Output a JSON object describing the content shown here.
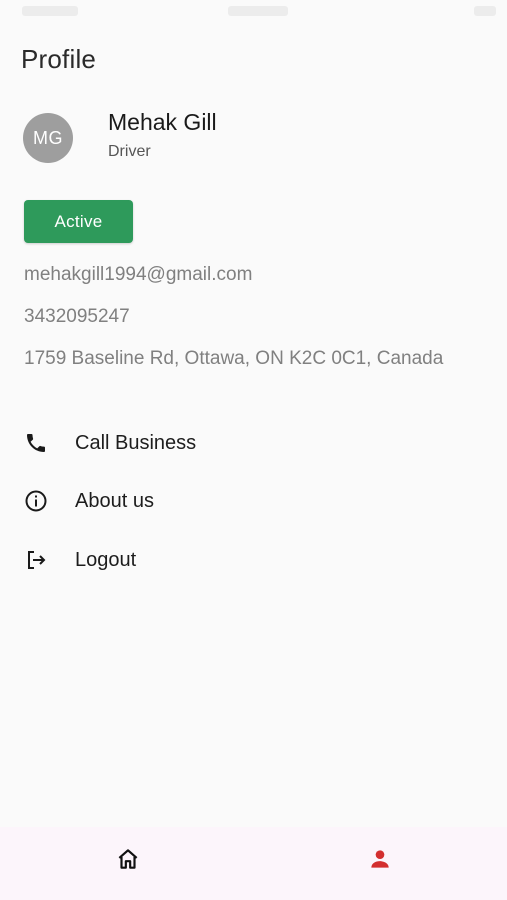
{
  "header": {
    "title": "Profile"
  },
  "profile": {
    "initials": "MG",
    "name": "Mehak Gill",
    "role": "Driver",
    "status": "Active",
    "email": "mehakgill1994@gmail.com",
    "phone": "3432095247",
    "address": "1759 Baseline Rd, Ottawa, ON K2C 0C1, Canada"
  },
  "menu": {
    "items": [
      {
        "label": "Call Business",
        "icon": "phone-icon"
      },
      {
        "label": "About us",
        "icon": "info-icon"
      },
      {
        "label": "Logout",
        "icon": "logout-icon"
      }
    ]
  },
  "bottom_nav": {
    "items": [
      {
        "icon": "home-icon",
        "active": false
      },
      {
        "icon": "person-icon",
        "active": true
      }
    ]
  },
  "colors": {
    "status_active": "#2e9a5b",
    "avatar_bg": "#9e9e9e",
    "nav_active": "#d32f2f",
    "nav_bg": "#fcf5fb"
  }
}
